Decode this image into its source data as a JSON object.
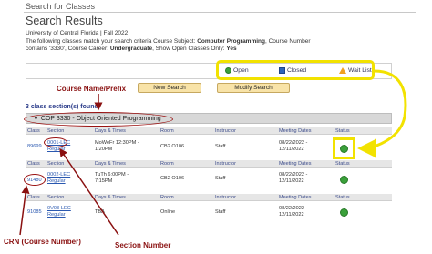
{
  "header": {
    "search_link": "Search for Classes",
    "title": "Search Results",
    "term": "University of Central Florida | Fall 2022",
    "criteria_prefix": "The following classes match your search criteria Course Subject:",
    "criteria_subject": "Computer Programming",
    "criteria_mid": ",  Course Number contains '3330',  Course Career:",
    "criteria_career": "Undergraduate",
    "criteria_open_label": ",  Show Open Classes Only:",
    "criteria_open": "Yes"
  },
  "legend": {
    "open": "Open",
    "closed": "Closed",
    "waitlist": "Wait List",
    "open_color": "#3aa03a",
    "closed_color": "#2e63b8",
    "waitlist_color": "#f0a020"
  },
  "buttons": {
    "new_search": "New Search",
    "modify_search": "Modify Search"
  },
  "results": {
    "sections_found": "3 class section(s) found",
    "course_title": "COP 3330 - Object Oriented Programming"
  },
  "table": {
    "headers": [
      "Class",
      "Section",
      "Days & Times",
      "Room",
      "Instructor",
      "Meeting Dates",
      "Status"
    ],
    "rows": [
      {
        "class": "89699",
        "section": "0001-LEC",
        "section_type": "Regular",
        "days1": "MoWeFr 12:30PM -",
        "days2": "1:20PM",
        "room": "CB2 O106",
        "instructor": "Staff",
        "dates1": "08/22/2022 -",
        "dates2": "12/11/2022",
        "status": "Open"
      },
      {
        "class": "91480",
        "section": "0002-LEC",
        "section_type": "Regular",
        "days1": "TuTh 6:00PM -",
        "days2": "7:15PM",
        "room": "CB2 O106",
        "instructor": "Staff",
        "dates1": "08/22/2022 -",
        "dates2": "12/11/2022",
        "status": "Open"
      },
      {
        "class": "91085",
        "section": "0V03-LEC",
        "section_type": "Regular",
        "days1": "TBA",
        "days2": "",
        "room": "Online",
        "instructor": "Staff",
        "dates1": "08/22/2022 -",
        "dates2": "12/11/2022",
        "status": "Open"
      }
    ]
  },
  "annotations": {
    "course_name": "Course Name/Prefix",
    "crn": "CRN (Course Number)",
    "section_number": "Section Number",
    "annotation_color": "#8a1010",
    "highlight_color": "#f2e200"
  }
}
